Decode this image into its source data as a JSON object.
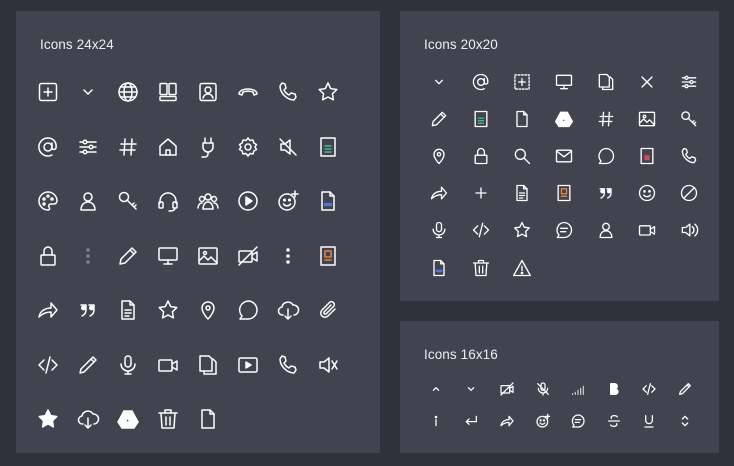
{
  "panels": [
    {
      "id": "p24",
      "title": "Icons 24x24",
      "icons": [
        "add-box",
        "chevron-down",
        "globe",
        "dashboard",
        "contact-card",
        "hang-up",
        "phone",
        "star",
        "at",
        "sliders",
        "hash",
        "home",
        "plug",
        "gear",
        "mute",
        "doc-green",
        "palette",
        "user",
        "key",
        "headset",
        "team",
        "play-circle",
        "emoji-add",
        "doc-blue",
        "lock",
        "dots-v-faint",
        "pencil",
        "monitor",
        "image",
        "video-off",
        "dots-v",
        "doc-orange",
        "share",
        "quote",
        "doc",
        "star",
        "location",
        "chat",
        "cloud-download",
        "paperclip",
        "code",
        "pen",
        "mic",
        "video",
        "copy",
        "play-box",
        "phone",
        "speaker-off",
        "star-filled",
        "cloud-download",
        "drive",
        "trash",
        "doc-blank"
      ]
    },
    {
      "id": "p20",
      "title": "Icons 20x20",
      "icons": [
        "chevron-down",
        "at",
        "add-box-dashed",
        "monitor",
        "copy",
        "close",
        "sliders",
        "pencil",
        "doc-green",
        "doc-blank",
        "drive",
        "hash",
        "image",
        "key",
        "location",
        "lock",
        "search",
        "mail",
        "chat",
        "doc-red",
        "phone",
        "share",
        "plus",
        "doc",
        "doc-orange",
        "quote",
        "smile",
        "block",
        "mic",
        "code",
        "star",
        "chat-lines",
        "user",
        "video",
        "volume",
        "doc-blue",
        "trash",
        "warning"
      ]
    },
    {
      "id": "p16",
      "title": "Icons 16x16",
      "icons": [
        "chevron-up",
        "chevron-down",
        "video-off",
        "mic-off",
        "signal",
        "bold",
        "code",
        "pen",
        "info",
        "return",
        "share",
        "emoji-add",
        "chat-lines",
        "strike",
        "underline",
        "unfold"
      ]
    }
  ],
  "colors": {
    "icon": "#ffffff",
    "green": "#3fb98b",
    "blue": "#4a7bdc",
    "orange": "#e8843a",
    "red": "#e0475b"
  }
}
